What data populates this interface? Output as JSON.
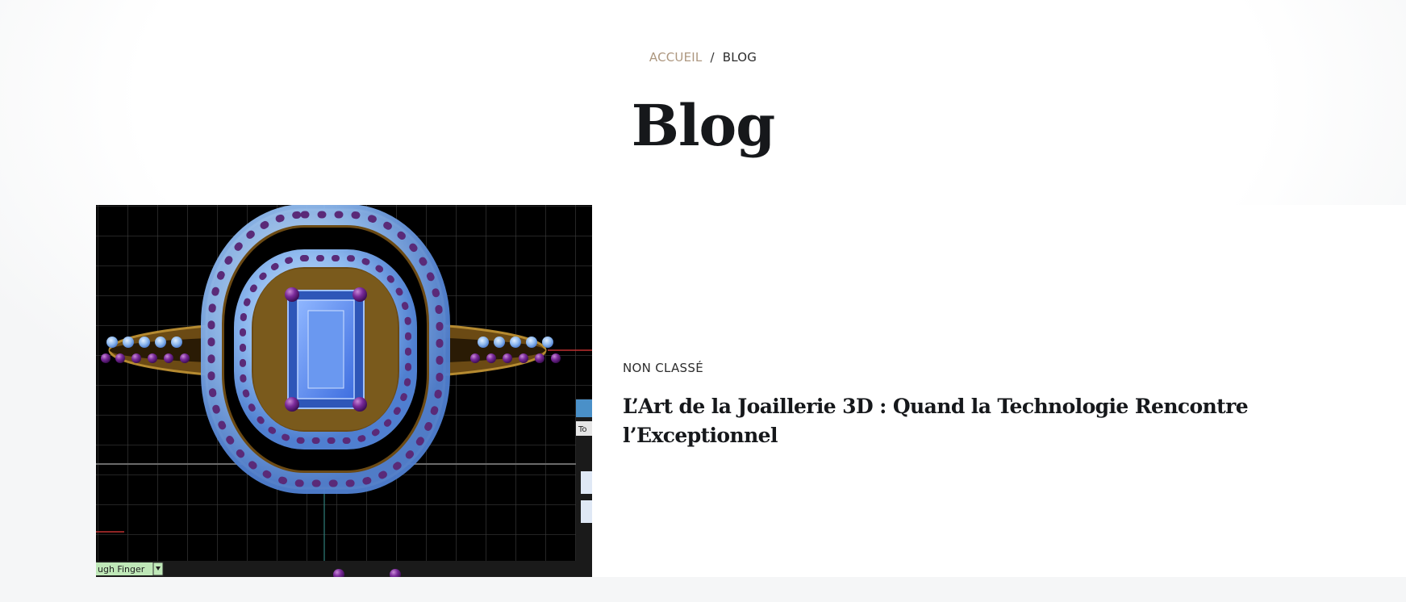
{
  "breadcrumb": {
    "home_label": "ACCUEIL",
    "separator": "/",
    "current_label": "BLOG"
  },
  "page": {
    "title": "Blog"
  },
  "post": {
    "category": "NON CLASSÉ",
    "title": "L’Art de la Joaillerie 3D : Quand la Technologie Rencontre l’Exceptionnel",
    "thumbnail": {
      "description": "3D jewelry CAD render of a ring with a blue emerald-cut gemstone surrounded by a double halo of purple and light-blue stones",
      "viewport_label": "ugh Finger",
      "toolbar_label": "To"
    }
  },
  "colors": {
    "accent": "#ad977f",
    "title": "#16181b",
    "background": "#f5f6f7"
  }
}
